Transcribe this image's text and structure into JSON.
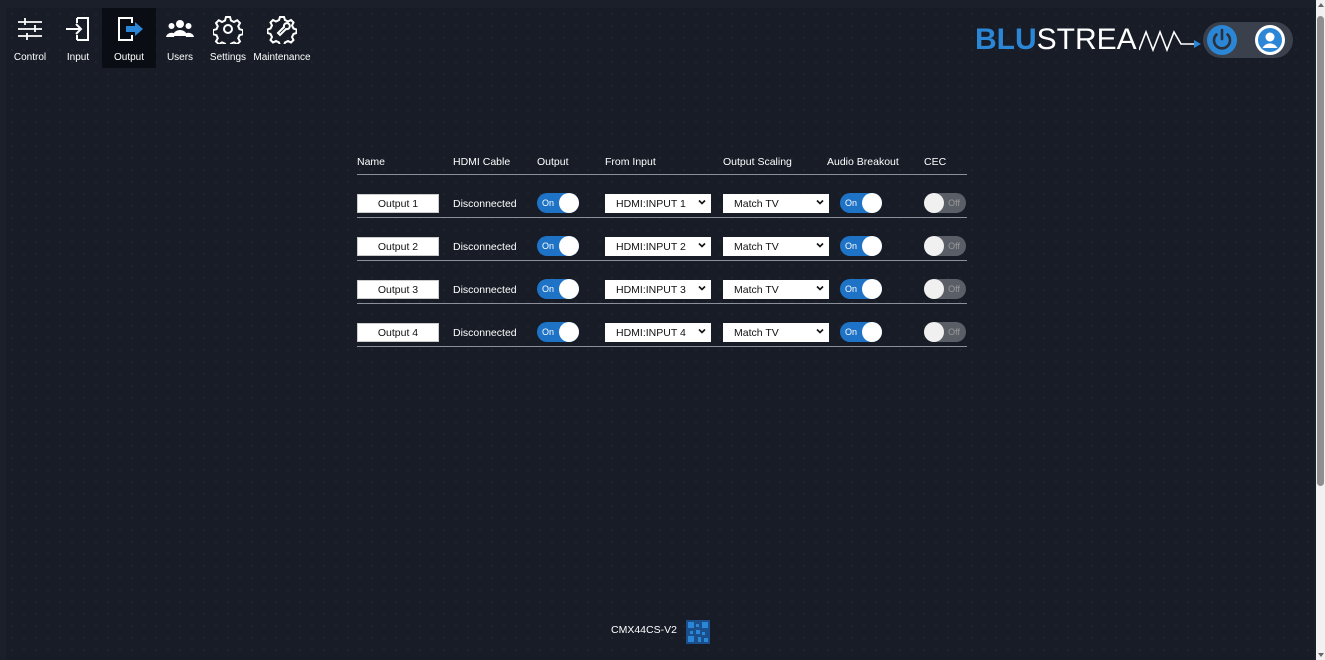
{
  "nav": [
    {
      "label": "Control",
      "icon": "sliders-icon"
    },
    {
      "label": "Input",
      "icon": "input-icon"
    },
    {
      "label": "Output",
      "icon": "output-icon",
      "active": true
    },
    {
      "label": "Users",
      "icon": "users-icon"
    },
    {
      "label": "Settings",
      "icon": "gear-icon"
    },
    {
      "label": "Maintenance",
      "icon": "wrench-gear-icon"
    }
  ],
  "brand": {
    "bold": "BLU",
    "rest": "STREA",
    "accent": "#2b86d6"
  },
  "table": {
    "headers": {
      "name": "Name",
      "hdmi": "HDMI Cable",
      "output": "Output",
      "from_input": "From Input",
      "scaling": "Output Scaling",
      "audio": "Audio Breakout",
      "cec": "CEC"
    },
    "on_label": "On",
    "off_label": "Off",
    "rows": [
      {
        "name": "Output 1",
        "hdmi": "Disconnected",
        "output": true,
        "from_input": "HDMI:INPUT 1",
        "scaling": "Match TV",
        "audio": true,
        "cec": false
      },
      {
        "name": "Output 2",
        "hdmi": "Disconnected",
        "output": true,
        "from_input": "HDMI:INPUT 2",
        "scaling": "Match TV",
        "audio": true,
        "cec": false
      },
      {
        "name": "Output 3",
        "hdmi": "Disconnected",
        "output": true,
        "from_input": "HDMI:INPUT 3",
        "scaling": "Match TV",
        "audio": true,
        "cec": false
      },
      {
        "name": "Output 4",
        "hdmi": "Disconnected",
        "output": true,
        "from_input": "HDMI:INPUT 4",
        "scaling": "Match TV",
        "audio": true,
        "cec": false
      }
    ]
  },
  "footer": {
    "model": "CMX44CS-V2"
  },
  "colors": {
    "toggle_on": "#1e73c6",
    "toggle_off": "#5a5e66",
    "background": "#171c26"
  }
}
